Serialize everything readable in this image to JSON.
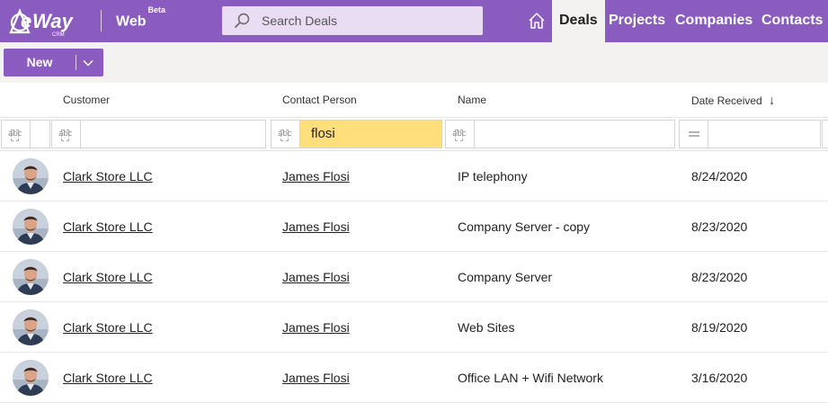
{
  "app": {
    "logo_text": "eWay",
    "logo_sub": "CRM",
    "web_label": "Web",
    "web_beta": "Beta"
  },
  "search": {
    "placeholder": "Search Deals"
  },
  "nav": {
    "items": [
      {
        "label": "Deals",
        "active": true
      },
      {
        "label": "Projects"
      },
      {
        "label": "Companies"
      },
      {
        "label": "Contacts"
      }
    ]
  },
  "toolbar": {
    "new_label": "New"
  },
  "grid": {
    "columns": [
      {
        "label": "Customer"
      },
      {
        "label": "Contact Person"
      },
      {
        "label": "Name"
      },
      {
        "label": "Date Received",
        "sort": "↓"
      }
    ],
    "filters": {
      "customer": "",
      "contact_person": "flosi",
      "name": "",
      "date_received": ""
    },
    "rows": [
      {
        "customer": "Clark Store LLC",
        "contact": "James Flosi",
        "name": "IP telephony",
        "date": "8/24/2020"
      },
      {
        "customer": "Clark Store LLC",
        "contact": "James Flosi",
        "name": "Company Server - copy",
        "date": "8/23/2020"
      },
      {
        "customer": "Clark Store LLC",
        "contact": "James Flosi",
        "name": "Company Server",
        "date": "8/23/2020"
      },
      {
        "customer": "Clark Store LLC",
        "contact": "James Flosi",
        "name": "Web Sites",
        "date": "8/19/2020"
      },
      {
        "customer": "Clark Store LLC",
        "contact": "James Flosi",
        "name": "Office LAN + Wifi Network",
        "date": "3/16/2020"
      }
    ]
  },
  "colors": {
    "brand": "#8a5cbf",
    "highlight": "#ffdf7b",
    "search_bg": "#e9ddf4"
  }
}
